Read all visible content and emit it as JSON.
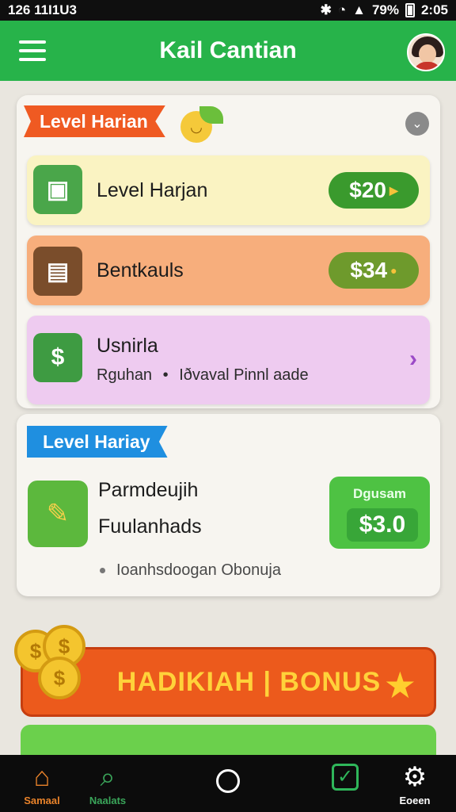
{
  "status_bar": {
    "time_left": "126 11I1U3",
    "battery": "79%",
    "clock": "2:05"
  },
  "header": {
    "title": "Kail Cantian"
  },
  "card1": {
    "ribbon_label": "Level Harian",
    "rows": [
      {
        "title": "Level Harjan",
        "amount": "$20"
      },
      {
        "title": "Bentkauls",
        "amount": "$34"
      },
      {
        "title": "Usnirla",
        "subtitle_a": "Rguhan",
        "subtitle_b": "Iðvaval Pinnl aade"
      }
    ]
  },
  "card2": {
    "ribbon_label": "Level Hariay",
    "line1": "Parmdeujih",
    "line2": "Fuulanhads",
    "bonus_label": "Dgusam",
    "bonus_value": "$3.0",
    "note": "Ioanhsdoogan Obonuja"
  },
  "banner": {
    "text": "HADIKIAH | BONUS"
  },
  "bottom_nav": [
    {
      "label": "Samaal",
      "icon": "home-icon"
    },
    {
      "label": "Naalats",
      "icon": "search-icon"
    },
    {
      "label": "",
      "icon": "circle-home-icon"
    },
    {
      "label": "",
      "icon": "task-check-icon"
    },
    {
      "label": "Eoeen",
      "icon": "gear-icon"
    }
  ]
}
